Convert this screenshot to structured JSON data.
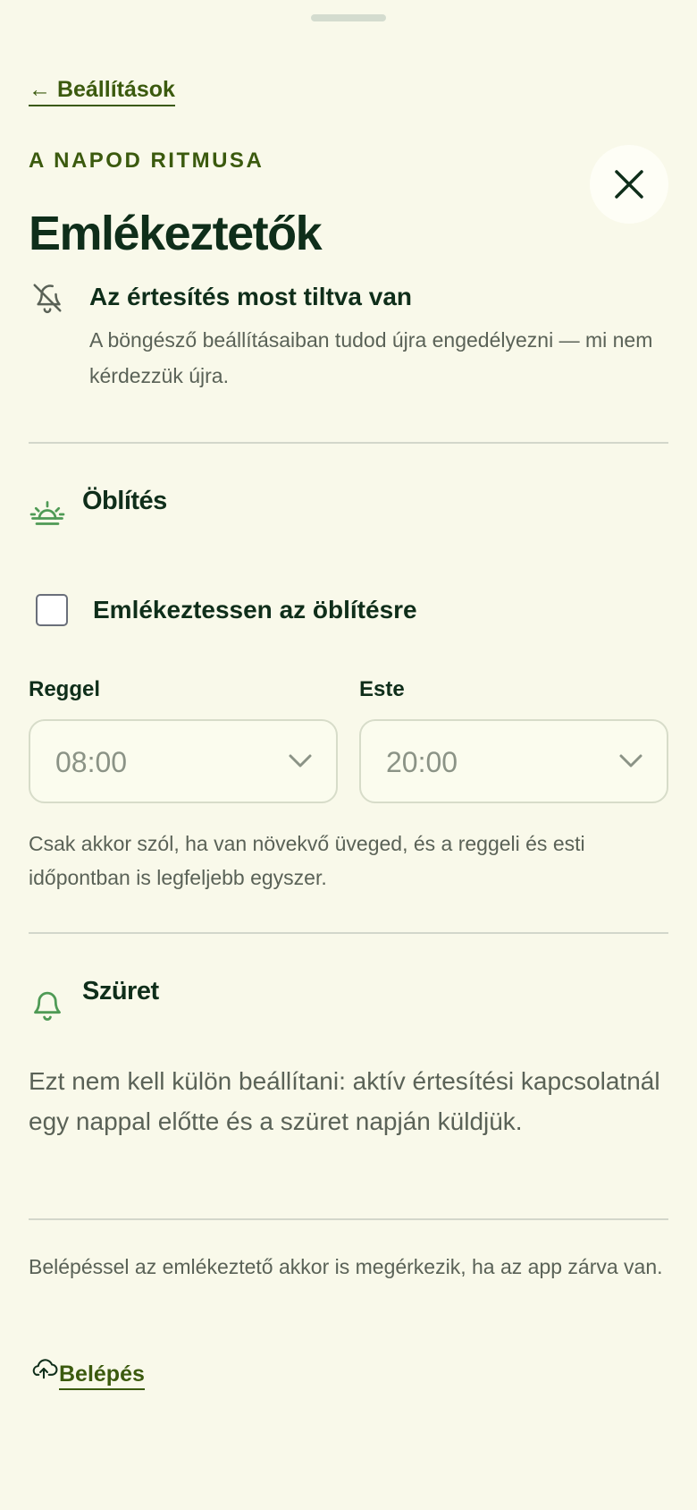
{
  "header": {
    "back_label": "← Beállítások",
    "eyebrow": "A NAPOD RITMUSA",
    "title": "Emlékeztetők"
  },
  "notice": {
    "icon": "bell-off-icon",
    "title": "Az értesítés most tiltva van",
    "description": "A böngésző beállításaiban tudod újra engedélyezni — mi nem kérdezzük újra."
  },
  "rinse": {
    "icon": "sunrise-icon",
    "title": "Öblítés",
    "checkbox_label": "Emlékeztessen az öblítésre",
    "checkbox_checked": false,
    "morning_label": "Reggel",
    "morning_value": "08:00",
    "evening_label": "Este",
    "evening_value": "20:00",
    "hint": "Csak akkor szól, ha van növekvő üveged, és a reggeli és esti időpontban is legfeljebb egyszer."
  },
  "harvest": {
    "icon": "bell-icon",
    "title": "Szüret",
    "text": "Ezt nem kell külön beállítani: aktív értesítési kapcsolatnál egy nappal előtte és a szüret napján küldjük."
  },
  "footer": {
    "text": "Belépéssel az emlékeztető akkor is megérkezik, ha az app zárva van.",
    "login_icon": "cloud-upload-icon",
    "login_label": "Belépés"
  },
  "colors": {
    "background": "#f9f9ea",
    "heading": "#0f2e1a",
    "accent": "#3b5a0e",
    "icon_green": "#4f9a55",
    "muted_text": "#5a6257"
  }
}
